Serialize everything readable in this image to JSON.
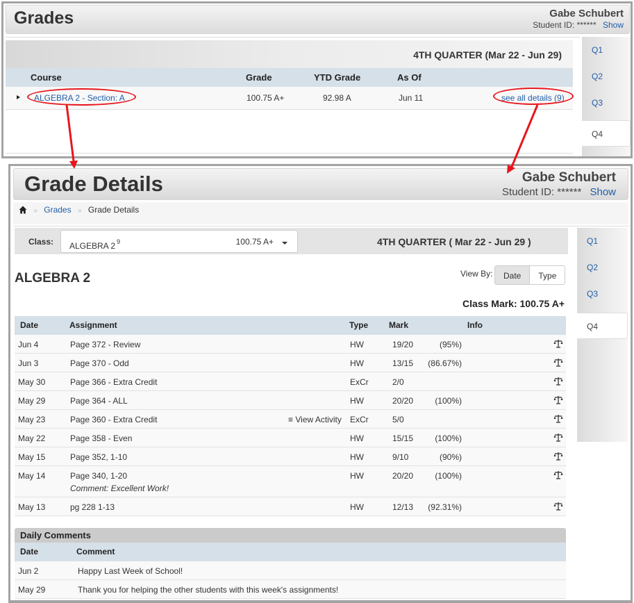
{
  "grades_page": {
    "title": "Grades",
    "student_name": "Gabe Schubert",
    "student_id_label": "Student ID:",
    "student_id_masked": "******",
    "show_link": "Show",
    "quarter_title": "4TH QUARTER (Mar 22 - Jun 29)",
    "columns": [
      "Course",
      "Grade",
      "YTD Grade",
      "As Of"
    ],
    "course_row": {
      "course": "ALGEBRA 2 - Section: A",
      "grade": "100.75 A+",
      "ytd_grade": "92.98 A",
      "as_of": "Jun 11",
      "details_link": "see all details (9)"
    },
    "quarter_tabs": [
      "Q1",
      "Q2",
      "Q3",
      "Q4"
    ],
    "active_quarter": "Q4"
  },
  "annotations": {
    "color": "#e8151b"
  },
  "details_page": {
    "title": "Grade Details",
    "student_name": "Gabe Schubert",
    "student_id_label": "Student ID:",
    "student_id_masked": "******",
    "show_link": "Show",
    "breadcrumb": {
      "home_icon": "home-icon",
      "items": [
        "Grades",
        "Grade Details"
      ]
    },
    "class_label": "Class:",
    "class_select": {
      "name": "ALGEBRA 2",
      "count": "9",
      "grade": "100.75 A+"
    },
    "quarter_title": "4TH QUARTER ( Mar 22 - Jun 29 )",
    "quarter_tabs": [
      "Q1",
      "Q2",
      "Q3",
      "Q4"
    ],
    "active_quarter": "Q4",
    "course_title": "ALGEBRA 2",
    "view_by_label": "View By:",
    "view_by_options": [
      "Date",
      "Type"
    ],
    "view_by_selected": "Date",
    "class_mark": "Class Mark: 100.75 A+",
    "assignments_columns": [
      "Date",
      "Assignment",
      "Type",
      "Mark",
      "Info"
    ],
    "assignments": [
      {
        "date": "Jun 4",
        "assignment": "Page 372 - Review",
        "type": "HW",
        "mark": "19/20",
        "percent": "(95%)"
      },
      {
        "date": "Jun 3",
        "assignment": "Page 370 - Odd",
        "type": "HW",
        "mark": "13/15",
        "percent": "(86.67%)"
      },
      {
        "date": "May 30",
        "assignment": "Page 366 - Extra Credit",
        "type": "ExCr",
        "mark": "2/0",
        "percent": ""
      },
      {
        "date": "May 29",
        "assignment": "Page 364 - ALL",
        "type": "HW",
        "mark": "20/20",
        "percent": "(100%)"
      },
      {
        "date": "May 23",
        "assignment": "Page 360 - Extra Credit",
        "type": "ExCr",
        "mark": "5/0",
        "percent": "",
        "link": "View Activity"
      },
      {
        "date": "May 22",
        "assignment": "Page 358 - Even",
        "type": "HW",
        "mark": "15/15",
        "percent": "(100%)"
      },
      {
        "date": "May 15",
        "assignment": "Page 352, 1-10",
        "type": "HW",
        "mark": "9/10",
        "percent": "(90%)"
      },
      {
        "date": "May 14",
        "assignment": "Page 340, 1-20",
        "type": "HW",
        "mark": "20/20",
        "percent": "(100%)",
        "comment": "Comment: Excellent Work!"
      },
      {
        "date": "May 13",
        "assignment": "pg 228 1-13",
        "type": "HW",
        "mark": "12/13",
        "percent": "(92.31%)"
      }
    ],
    "daily_comments": {
      "title": "Daily Comments",
      "columns": [
        "Date",
        "Comment"
      ],
      "rows": [
        {
          "date": "Jun 2",
          "comment": "Happy Last Week of School!"
        },
        {
          "date": "May 29",
          "comment": "Thank you for helping the other students with this week's assignments!"
        }
      ]
    }
  }
}
